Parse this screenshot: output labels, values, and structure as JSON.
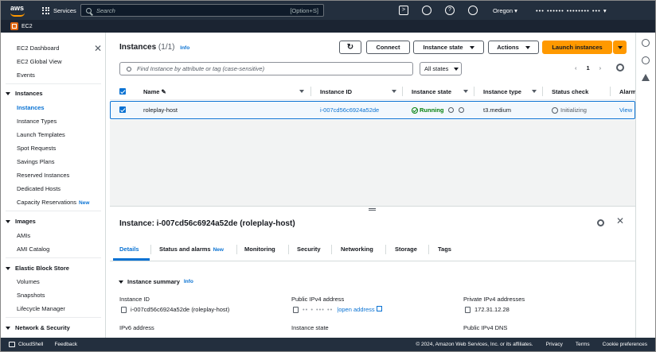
{
  "topnav": {
    "logo_text": "aws",
    "services_label": "Services",
    "search_placeholder": "Search",
    "search_shortcut": "[Option+S]",
    "region": "Oregon ▾",
    "account": "••• ••••••  •••••••• ••• ▾"
  },
  "subbar": {
    "service": "EC2"
  },
  "sidebar": {
    "top_items": [
      "EC2 Dashboard",
      "EC2 Global View",
      "Events"
    ],
    "sections": [
      {
        "title": "Instances",
        "items": [
          "Instances",
          "Instance Types",
          "Launch Templates",
          "Spot Requests",
          "Savings Plans",
          "Reserved Instances",
          "Dedicated Hosts",
          "Capacity Reservations"
        ]
      },
      {
        "title": "Images",
        "items": [
          "AMIs",
          "AMI Catalog"
        ]
      },
      {
        "title": "Elastic Block Store",
        "items": [
          "Volumes",
          "Snapshots",
          "Lifecycle Manager"
        ]
      },
      {
        "title": "Network & Security",
        "items": []
      }
    ],
    "new_badge": "New"
  },
  "instances": {
    "title": "Instances",
    "count": "(1/1)",
    "info": "Info",
    "connect": "Connect",
    "instance_state": "Instance state",
    "actions": "Actions",
    "launch": "Launch instances",
    "filter_placeholder": "Find Instance by attribute or tag (case-sensitive)",
    "states_filter": "All states",
    "page": "1",
    "columns": [
      "Name",
      "Instance ID",
      "Instance state",
      "Instance type",
      "Status check",
      "Alarm"
    ],
    "rows": [
      {
        "name": "roleplay-host",
        "id": "i-007cd56c6924a52de",
        "state": "Running",
        "type": "t3.medium",
        "status": "Initializing",
        "alarm": "View"
      }
    ]
  },
  "detail": {
    "title": "Instance: i-007cd56c6924a52de (roleplay-host)",
    "tabs": [
      "Details",
      "Status and alarms",
      "Monitoring",
      "Security",
      "Networking",
      "Storage",
      "Tags"
    ],
    "tab_new": "New",
    "summary": "Instance summary",
    "info": "Info",
    "fields": {
      "instance_id_label": "Instance ID",
      "instance_id_value": "i-007cd56c6924a52de (roleplay-host)",
      "public_ipv4_label": "Public IPv4 address",
      "public_ipv4_value": "•• • ••• ••",
      "open_address": "open address",
      "private_ipv4_label": "Private IPv4 addresses",
      "private_ipv4_value": "172.31.12.28",
      "ipv6_label": "IPv6 address",
      "instance_state_label": "Instance state",
      "public_dns_label": "Public IPv4 DNS"
    }
  },
  "footer": {
    "cloudshell": "CloudShell",
    "feedback": "Feedback",
    "copyright": "© 2024, Amazon Web Services, Inc. or its affiliates.",
    "privacy": "Privacy",
    "terms": "Terms",
    "cookies": "Cookie preferences"
  },
  "colors": {
    "nav": "#232f3e",
    "accent": "#ff9900",
    "link": "#0972d3",
    "running": "#037f0c"
  }
}
